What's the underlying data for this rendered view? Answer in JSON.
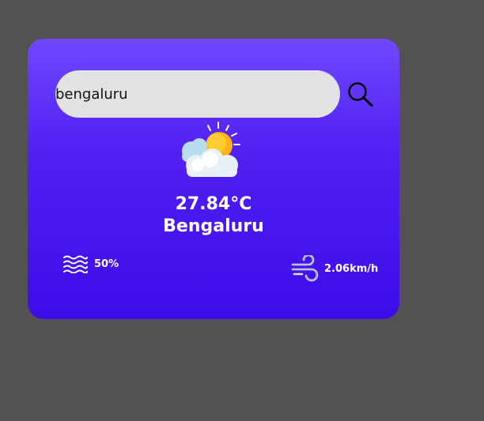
{
  "search": {
    "value": "bengaluru",
    "placeholder": ""
  },
  "icons": {
    "search": "search-icon",
    "weather": "partly-cloudy-icon",
    "humidity": "humidity-waves-icon",
    "wind": "wind-icon"
  },
  "weather": {
    "temperature": "27.84°C",
    "city": "Bengaluru",
    "humidity": "50%",
    "wind_speed": "2.06km/h"
  },
  "colors": {
    "background": "#535152",
    "card_gradient_top": "#6f48ff",
    "card_gradient_bottom": "#3d0ce8",
    "input_bg": "#e2e2e2",
    "text": "#ffffff"
  }
}
